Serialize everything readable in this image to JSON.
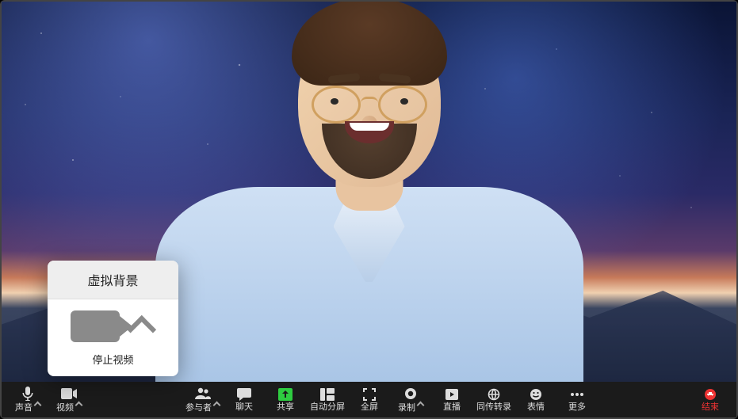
{
  "popup": {
    "title": "虚拟背景",
    "stop_video_label": "停止视频"
  },
  "toolbar": {
    "group_left": [
      {
        "id": "audio",
        "label": "声音",
        "icon": "mic-icon",
        "has_caret": true
      },
      {
        "id": "video",
        "label": "视频",
        "icon": "camera-icon",
        "has_caret": true
      }
    ],
    "group_center": [
      {
        "id": "participants",
        "label": "参与者",
        "icon": "participants-icon",
        "has_caret": true
      },
      {
        "id": "chat",
        "label": "聊天",
        "icon": "chat-icon",
        "has_caret": false
      },
      {
        "id": "share",
        "label": "共享",
        "icon": "share-icon",
        "has_caret": false
      },
      {
        "id": "auto_split",
        "label": "自动分屏",
        "icon": "split-screen-icon",
        "has_caret": false
      },
      {
        "id": "fullscreen",
        "label": "全屏",
        "icon": "fullscreen-icon",
        "has_caret": false
      },
      {
        "id": "record",
        "label": "录制",
        "icon": "record-icon",
        "has_caret": true
      },
      {
        "id": "live",
        "label": "直播",
        "icon": "live-icon",
        "has_caret": false
      },
      {
        "id": "interpretation",
        "label": "同传转录",
        "icon": "interpretation-icon",
        "has_caret": false
      },
      {
        "id": "reactions",
        "label": "表情",
        "icon": "reactions-icon",
        "has_caret": false
      },
      {
        "id": "more",
        "label": "更多",
        "icon": "more-icon",
        "has_caret": false
      }
    ],
    "end": {
      "label": "结束",
      "icon": "end-icon"
    }
  }
}
